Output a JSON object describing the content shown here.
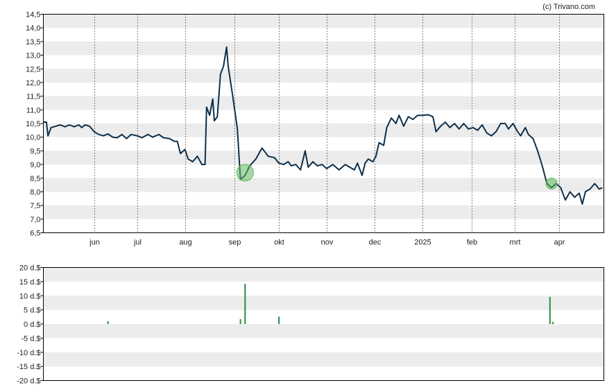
{
  "credit": "(c) Trivano.com",
  "colors": {
    "line": "#0d2f4a",
    "band": "#ececec",
    "grid_month": "#000000",
    "marker": "#5cb85c",
    "volume_bar": "#2e8b3d",
    "frame": "#000000"
  },
  "chart_data": [
    {
      "type": "line",
      "title": "",
      "xlabel": "",
      "ylabel": "",
      "ylim": [
        6.5,
        14.5
      ],
      "yticks": [
        "14,5",
        "14,0",
        "13,5",
        "13,0",
        "12,5",
        "12,0",
        "11,5",
        "11,0",
        "10,5",
        "10,0",
        "9,5",
        "9,0",
        "8,5",
        "8,0",
        "7,5",
        "7,0",
        "6,5"
      ],
      "ytick_values": [
        14.5,
        14.0,
        13.5,
        13.0,
        12.5,
        12.0,
        11.5,
        11.0,
        10.5,
        10.0,
        9.5,
        9.0,
        8.5,
        8.0,
        7.5,
        7.0,
        6.5
      ],
      "grid": "horizontal bands, dotted vertical month lines",
      "xlim": [
        "2024-05-01",
        "2025-04-30"
      ],
      "xticks": [
        {
          "label": "jun",
          "date": "2024-06-03"
        },
        {
          "label": "jul",
          "date": "2024-07-01"
        },
        {
          "label": "aug",
          "date": "2024-08-01"
        },
        {
          "label": "sep",
          "date": "2024-09-02"
        },
        {
          "label": "okt",
          "date": "2024-10-01"
        },
        {
          "label": "nov",
          "date": "2024-11-01"
        },
        {
          "label": "dec",
          "date": "2024-12-02"
        },
        {
          "label": "2025",
          "date": "2025-01-02"
        },
        {
          "label": "feb",
          "date": "2025-02-03"
        },
        {
          "label": "mrt",
          "date": "2025-03-03"
        },
        {
          "label": "apr",
          "date": "2025-04-01"
        }
      ],
      "series": [
        {
          "points": [
            [
              "2024-05-01",
              10.55
            ],
            [
              "2024-05-03",
              10.55
            ],
            [
              "2024-05-04",
              10.05
            ],
            [
              "2024-05-06",
              10.35
            ],
            [
              "2024-05-09",
              10.4
            ],
            [
              "2024-05-12",
              10.45
            ],
            [
              "2024-05-15",
              10.38
            ],
            [
              "2024-05-18",
              10.45
            ],
            [
              "2024-05-21",
              10.38
            ],
            [
              "2024-05-24",
              10.45
            ],
            [
              "2024-05-26",
              10.35
            ],
            [
              "2024-05-28",
              10.45
            ],
            [
              "2024-05-31",
              10.4
            ],
            [
              "2024-06-03",
              10.2
            ],
            [
              "2024-06-06",
              10.1
            ],
            [
              "2024-06-09",
              10.05
            ],
            [
              "2024-06-12",
              10.12
            ],
            [
              "2024-06-15",
              10.0
            ],
            [
              "2024-06-18",
              9.98
            ],
            [
              "2024-06-21",
              10.1
            ],
            [
              "2024-06-24",
              9.95
            ],
            [
              "2024-06-27",
              10.1
            ],
            [
              "2024-07-01",
              10.05
            ],
            [
              "2024-07-04",
              9.98
            ],
            [
              "2024-07-08",
              10.1
            ],
            [
              "2024-07-11",
              10.0
            ],
            [
              "2024-07-15",
              10.1
            ],
            [
              "2024-07-18",
              9.98
            ],
            [
              "2024-07-22",
              9.95
            ],
            [
              "2024-07-25",
              9.85
            ],
            [
              "2024-07-27",
              9.85
            ],
            [
              "2024-07-29",
              9.4
            ],
            [
              "2024-08-01",
              9.55
            ],
            [
              "2024-08-03",
              9.2
            ],
            [
              "2024-08-06",
              9.1
            ],
            [
              "2024-08-09",
              9.3
            ],
            [
              "2024-08-12",
              9.0
            ],
            [
              "2024-08-14",
              9.0
            ],
            [
              "2024-08-15",
              11.1
            ],
            [
              "2024-08-17",
              10.8
            ],
            [
              "2024-08-19",
              11.4
            ],
            [
              "2024-08-20",
              10.6
            ],
            [
              "2024-08-22",
              10.75
            ],
            [
              "2024-08-24",
              12.3
            ],
            [
              "2024-08-26",
              12.6
            ],
            [
              "2024-08-28",
              13.3
            ],
            [
              "2024-08-29",
              12.6
            ],
            [
              "2024-09-01",
              11.5
            ],
            [
              "2024-09-04",
              10.3
            ],
            [
              "2024-09-06",
              8.45
            ],
            [
              "2024-09-09",
              8.6
            ],
            [
              "2024-09-12",
              8.95
            ],
            [
              "2024-09-16",
              9.2
            ],
            [
              "2024-09-20",
              9.6
            ],
            [
              "2024-09-24",
              9.3
            ],
            [
              "2024-09-28",
              9.25
            ],
            [
              "2024-10-01",
              9.05
            ],
            [
              "2024-10-04",
              9.0
            ],
            [
              "2024-10-07",
              9.1
            ],
            [
              "2024-10-09",
              8.95
            ],
            [
              "2024-10-12",
              9.0
            ],
            [
              "2024-10-15",
              8.8
            ],
            [
              "2024-10-18",
              9.5
            ],
            [
              "2024-10-20",
              8.9
            ],
            [
              "2024-10-23",
              9.1
            ],
            [
              "2024-10-26",
              8.95
            ],
            [
              "2024-10-29",
              9.0
            ],
            [
              "2024-11-01",
              8.85
            ],
            [
              "2024-11-05",
              9.0
            ],
            [
              "2024-11-09",
              8.8
            ],
            [
              "2024-11-13",
              9.0
            ],
            [
              "2024-11-16",
              8.9
            ],
            [
              "2024-11-19",
              8.8
            ],
            [
              "2024-11-21",
              9.05
            ],
            [
              "2024-11-24",
              8.6
            ],
            [
              "2024-11-26",
              9.05
            ],
            [
              "2024-11-28",
              9.2
            ],
            [
              "2024-12-01",
              9.1
            ],
            [
              "2024-12-03",
              9.3
            ],
            [
              "2024-12-05",
              9.8
            ],
            [
              "2024-12-08",
              9.7
            ],
            [
              "2024-12-10",
              10.35
            ],
            [
              "2024-12-13",
              10.7
            ],
            [
              "2024-12-16",
              10.5
            ],
            [
              "2024-12-18",
              10.8
            ],
            [
              "2024-12-21",
              10.4
            ],
            [
              "2024-12-24",
              10.75
            ],
            [
              "2024-12-27",
              10.65
            ],
            [
              "2024-12-30",
              10.8
            ],
            [
              "2025-01-02",
              10.8
            ],
            [
              "2025-01-06",
              10.82
            ],
            [
              "2025-01-09",
              10.75
            ],
            [
              "2025-01-11",
              10.2
            ],
            [
              "2025-01-14",
              10.4
            ],
            [
              "2025-01-17",
              10.55
            ],
            [
              "2025-01-20",
              10.35
            ],
            [
              "2025-01-23",
              10.5
            ],
            [
              "2025-01-26",
              10.3
            ],
            [
              "2025-01-29",
              10.5
            ],
            [
              "2025-02-01",
              10.3
            ],
            [
              "2025-02-04",
              10.35
            ],
            [
              "2025-02-07",
              10.25
            ],
            [
              "2025-02-10",
              10.45
            ],
            [
              "2025-02-13",
              10.15
            ],
            [
              "2025-02-16",
              10.05
            ],
            [
              "2025-02-19",
              10.2
            ],
            [
              "2025-02-22",
              10.5
            ],
            [
              "2025-02-25",
              10.5
            ],
            [
              "2025-02-27",
              10.3
            ],
            [
              "2025-03-02",
              10.5
            ],
            [
              "2025-03-05",
              10.2
            ],
            [
              "2025-03-07",
              10.05
            ],
            [
              "2025-03-10",
              10.35
            ],
            [
              "2025-03-12",
              10.1
            ],
            [
              "2025-03-15",
              9.95
            ],
            [
              "2025-03-18",
              9.5
            ],
            [
              "2025-03-21",
              8.95
            ],
            [
              "2025-03-24",
              8.3
            ],
            [
              "2025-03-27",
              8.15
            ],
            [
              "2025-03-30",
              8.3
            ],
            [
              "2025-04-02",
              8.15
            ],
            [
              "2025-04-05",
              7.7
            ],
            [
              "2025-04-08",
              8.0
            ],
            [
              "2025-04-11",
              7.8
            ],
            [
              "2025-04-14",
              7.95
            ],
            [
              "2025-04-16",
              7.55
            ],
            [
              "2025-04-18",
              8.0
            ],
            [
              "2025-04-21",
              8.1
            ],
            [
              "2025-04-24",
              8.3
            ],
            [
              "2025-04-27",
              8.1
            ],
            [
              "2025-04-29",
              8.15
            ]
          ]
        }
      ],
      "markers": [
        {
          "date": "2024-09-09",
          "value": 8.7
        },
        {
          "date": "2025-03-27",
          "value": 8.3
        }
      ]
    },
    {
      "type": "bar",
      "title": "",
      "xlabel": "",
      "ylabel": "",
      "ylim": [
        -20,
        20
      ],
      "yticks": [
        "20 d.$",
        "15 d.$",
        "10 d.$",
        "5 d.$",
        "0 d.$",
        "-5 d.$",
        "-10 d.$",
        "-15 d.$",
        "-20 d.$"
      ],
      "ytick_values": [
        20,
        15,
        10,
        5,
        0,
        -5,
        -10,
        -15,
        -20
      ],
      "grid": "horizontal bands",
      "bars": [
        {
          "date": "2024-06-12",
          "value": 1.0
        },
        {
          "date": "2024-09-06",
          "value": 1.7
        },
        {
          "date": "2024-09-09",
          "value": 14.2
        },
        {
          "date": "2024-10-01",
          "value": 2.6
        },
        {
          "date": "2025-03-26",
          "value": 9.6
        },
        {
          "date": "2025-03-28",
          "value": 0.8
        }
      ]
    }
  ]
}
